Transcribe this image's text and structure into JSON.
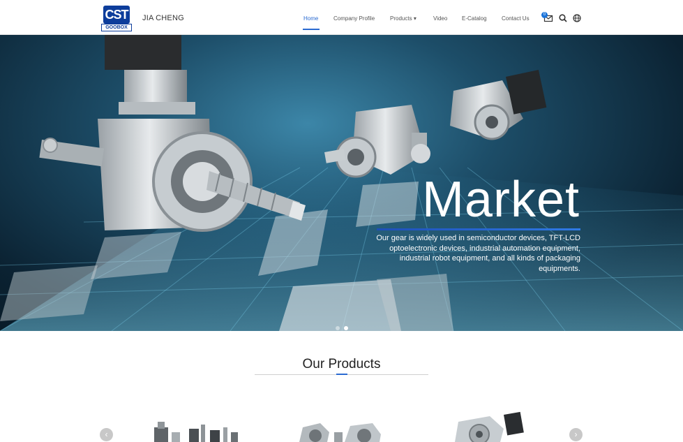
{
  "header": {
    "logo_text": "CST",
    "logo_subtext": "GOOBOX",
    "brand_name": "JIA CHENG",
    "nav": {
      "home": "Home",
      "company_profile": "Company Profile",
      "products": "Products",
      "products_caret": "▾",
      "video": "Video",
      "ecatalog": "E-Catalog",
      "contact": "Contact Us"
    },
    "mail_badge": "0",
    "icons": [
      "mail-icon",
      "search-icon",
      "globe-icon"
    ]
  },
  "hero": {
    "title": "Market",
    "description": "Our gear is widely used in semiconductor devices, TFT-LCD optoelectronic devices, industrial automation equipment, industrial robot equipment, and all kinds of packaging equipments.",
    "slide_count": 2,
    "active_slide": 2
  },
  "products": {
    "title": "Our Products",
    "prev_label": "‹",
    "next_label": "›"
  },
  "colors": {
    "accent": "#2a6ad1",
    "logo_blue": "#0d3d9b"
  }
}
